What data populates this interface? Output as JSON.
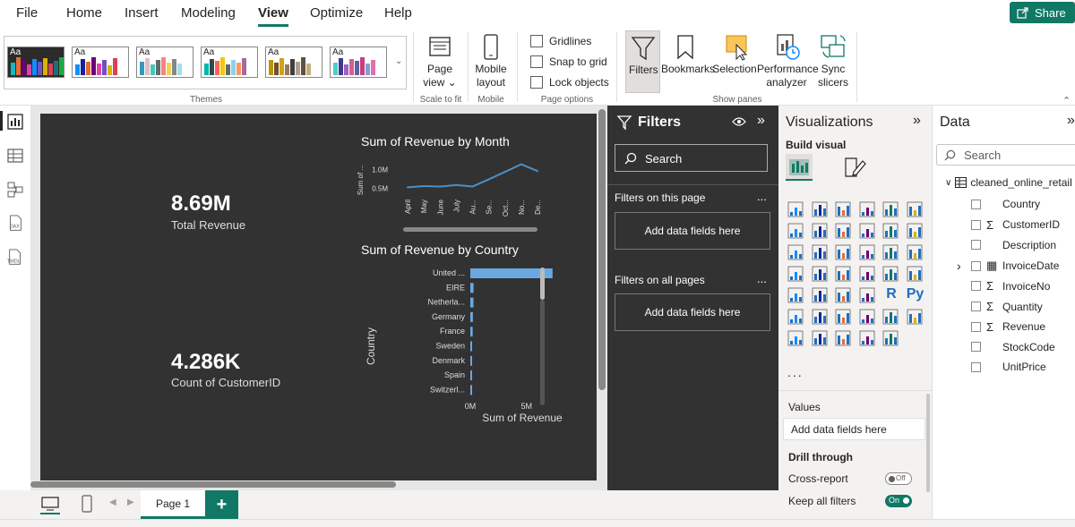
{
  "menu": {
    "items": [
      "File",
      "Home",
      "Insert",
      "Modeling",
      "View",
      "Optimize",
      "Help"
    ],
    "active": "View",
    "share_label": "Share"
  },
  "ribbon": {
    "theme_aa": "Aa",
    "themes_label": "Themes",
    "scale_label": "Scale to fit",
    "page_view_label": "Page view",
    "mobile_layout_label": "Mobile layout",
    "mobile_label": "Mobile",
    "gridlines_label": "Gridlines",
    "snap_label": "Snap to grid",
    "lock_label": "Lock objects",
    "page_options_label": "Page options",
    "filters_label": "Filters",
    "bookmarks_label": "Bookmarks",
    "selection_label": "Selection",
    "performance_label": "Performance analyzer",
    "sync_label": "Sync slicers",
    "show_panes_label": "Show panes"
  },
  "report": {
    "kpi1_value": "8.69M",
    "kpi1_label": "Total Revenue",
    "kpi2_value": "4.286K",
    "kpi2_label": "Count of CustomerID",
    "line_chart_title": "Sum of Revenue by Month",
    "bar_chart_title": "Sum of Revenue by Country"
  },
  "chart_data": [
    {
      "type": "line",
      "title": "Sum of Revenue by Month",
      "ylabel": "Sum of ...",
      "yticks": [
        "0.5M",
        "1.0M"
      ],
      "ylim": [
        0.3,
        1.25
      ],
      "categories": [
        "April",
        "May",
        "June",
        "July",
        "Au...",
        "Se...",
        "Oct...",
        "No...",
        "De..."
      ],
      "series": [
        {
          "values": [
            0.53,
            0.56,
            0.55,
            0.59,
            0.55,
            0.74,
            0.94,
            1.14,
            0.96
          ]
        }
      ],
      "color": "#4a90c8"
    },
    {
      "type": "bar",
      "orientation": "horizontal",
      "title": "Sum of Revenue by Country",
      "xlabel": "Sum of Revenue",
      "ylabel": "Country",
      "xticks": [
        "0M",
        "5M"
      ],
      "xlim": [
        0,
        9
      ],
      "categories": [
        "United ...",
        "EIRE",
        "Netherla...",
        "Germany",
        "France",
        "Sweden",
        "Denmark",
        "Spain",
        "Switzerl..."
      ],
      "values": [
        7.31,
        0.29,
        0.28,
        0.23,
        0.21,
        0.04,
        0.02,
        0.06,
        0.06
      ],
      "color": "#6aa9e0"
    }
  ],
  "filters": {
    "title": "Filters",
    "search_placeholder": "Search",
    "on_page_label": "Filters on this page",
    "on_all_label": "Filters on all pages",
    "add_fields": "Add data fields here",
    "more": "..."
  },
  "viz": {
    "title": "Visualizations",
    "build_label": "Build visual",
    "values_label": "Values",
    "add_fields": "Add data fields here",
    "drill_label": "Drill through",
    "cross_report_label": "Cross-report",
    "cross_report_state": "Off",
    "keep_filters_label": "Keep all filters",
    "keep_filters_state": "On",
    "more_icons": "...",
    "r_label": "R",
    "py_label": "Py"
  },
  "data": {
    "title": "Data",
    "search_placeholder": "Search",
    "table_name": "cleaned_online_retail",
    "fields": [
      {
        "name": "Country",
        "sigma": false,
        "date": false
      },
      {
        "name": "CustomerID",
        "sigma": true,
        "date": false
      },
      {
        "name": "Description",
        "sigma": false,
        "date": false
      },
      {
        "name": "InvoiceDate",
        "sigma": false,
        "date": true
      },
      {
        "name": "InvoiceNo",
        "sigma": true,
        "date": false
      },
      {
        "name": "Quantity",
        "sigma": true,
        "date": false
      },
      {
        "name": "Revenue",
        "sigma": true,
        "date": false
      },
      {
        "name": "StockCode",
        "sigma": false,
        "date": false
      },
      {
        "name": "UnitPrice",
        "sigma": false,
        "date": false
      }
    ]
  },
  "pages": {
    "tab": "Page 1",
    "add": "+"
  }
}
